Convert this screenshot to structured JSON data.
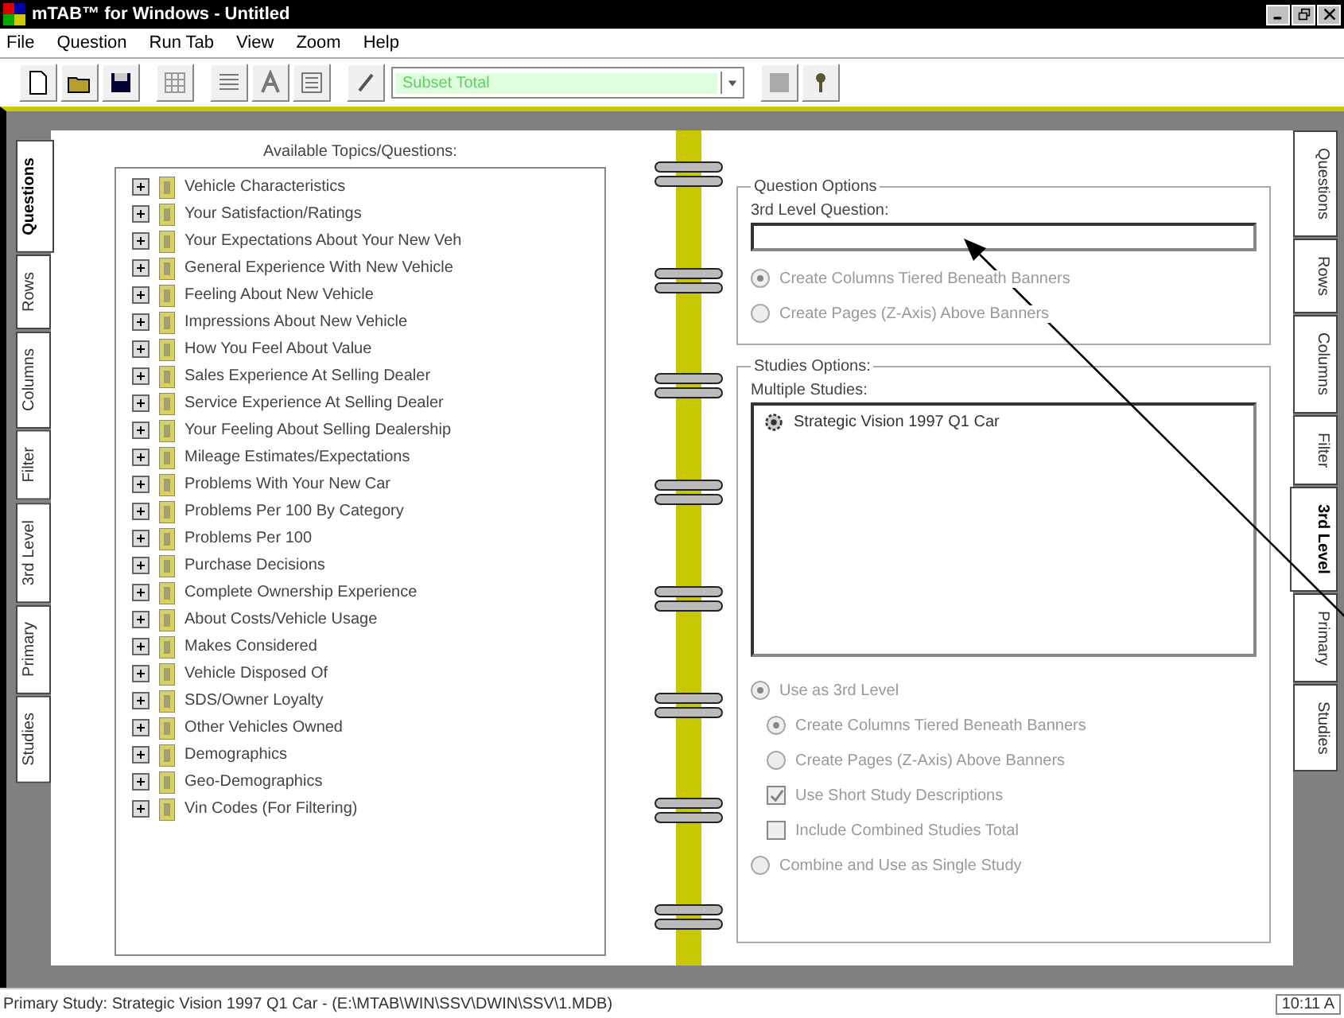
{
  "window": {
    "title": "mTAB™ for Windows - Untitled"
  },
  "menu": [
    "File",
    "Question",
    "Run Tab",
    "View",
    "Zoom",
    "Help"
  ],
  "toolbar": {
    "subset": {
      "value": "Subset Total"
    }
  },
  "left_tabs": [
    {
      "label": "Questions",
      "selected": true
    },
    {
      "label": "Rows",
      "selected": false
    },
    {
      "label": "Columns",
      "selected": false
    },
    {
      "label": "Filter",
      "selected": false
    },
    {
      "label": "3rd Level",
      "selected": false
    },
    {
      "label": "Primary",
      "selected": false
    },
    {
      "label": "Studies",
      "selected": false
    }
  ],
  "topics": {
    "heading": "Available Topics/Questions:",
    "items": [
      {
        "label": "Vehicle Characteristics"
      },
      {
        "label": "Your Satisfaction/Ratings"
      },
      {
        "label": "Your Expectations About Your New Veh"
      },
      {
        "label": "General Experience With New Vehicle"
      },
      {
        "label": "Feeling About New Vehicle"
      },
      {
        "label": "Impressions About New Vehicle"
      },
      {
        "label": "How You Feel About Value"
      },
      {
        "label": "Sales Experience At Selling Dealer"
      },
      {
        "label": "Service Experience At Selling Dealer"
      },
      {
        "label": "Your Feeling About Selling Dealership"
      },
      {
        "label": "Mileage Estimates/Expectations"
      },
      {
        "label": "Problems With Your New Car"
      },
      {
        "label": "Problems Per 100 By Category"
      },
      {
        "label": "Problems Per 100"
      },
      {
        "label": "Purchase Decisions"
      },
      {
        "label": "Complete Ownership Experience"
      },
      {
        "label": "About Costs/Vehicle Usage"
      },
      {
        "label": "Makes Considered"
      },
      {
        "label": "Vehicle Disposed Of"
      },
      {
        "label": "SDS/Owner Loyalty"
      },
      {
        "label": "Other Vehicles Owned"
      },
      {
        "label": "Demographics"
      },
      {
        "label": "Geo-Demographics"
      },
      {
        "label": "Vin Codes (For Filtering)"
      }
    ]
  },
  "question_options": {
    "title": "Question Options",
    "field_label": "3rd Level Question:",
    "radios": [
      {
        "label": "Create Columns Tiered Beneath Banners",
        "selected": true,
        "disabled": true
      },
      {
        "label": "Create Pages (Z-Axis) Above Banners",
        "selected": false,
        "disabled": true
      }
    ]
  },
  "studies_options": {
    "title": "Studies Options:",
    "list_label": "Multiple Studies:",
    "studies": [
      {
        "label": "Strategic Vision 1997 Q1 Car"
      }
    ],
    "options": [
      {
        "kind": "radio",
        "label": "Use as 3rd Level",
        "selected": true,
        "disabled": true,
        "children": [
          {
            "kind": "radio",
            "label": "Create Columns Tiered Beneath Banners",
            "selected": true,
            "disabled": true
          },
          {
            "kind": "radio",
            "label": "Create Pages (Z-Axis) Above Banners",
            "selected": false,
            "disabled": true
          },
          {
            "kind": "checkbox",
            "label": "Use Short Study Descriptions",
            "checked": true,
            "disabled": true
          },
          {
            "kind": "checkbox",
            "label": "Include Combined Studies Total",
            "checked": false,
            "disabled": true
          }
        ]
      },
      {
        "kind": "radio",
        "label": "Combine and Use as Single Study",
        "selected": false,
        "disabled": true
      }
    ]
  },
  "right_tabs": [
    {
      "label": "Questions",
      "selected": false
    },
    {
      "label": "Rows",
      "selected": false
    },
    {
      "label": "Columns",
      "selected": false
    },
    {
      "label": "Filter",
      "selected": false
    },
    {
      "label": "3rd Level",
      "selected": true
    },
    {
      "label": "Primary",
      "selected": false
    },
    {
      "label": "Studies",
      "selected": false
    }
  ],
  "status_bar": {
    "text": "Primary Study: Strategic Vision 1997 Q1 Car - (E:\\MTAB\\WIN\\SSV\\DWIN\\SSV\\1.MDB)",
    "time": "10:11 A"
  }
}
